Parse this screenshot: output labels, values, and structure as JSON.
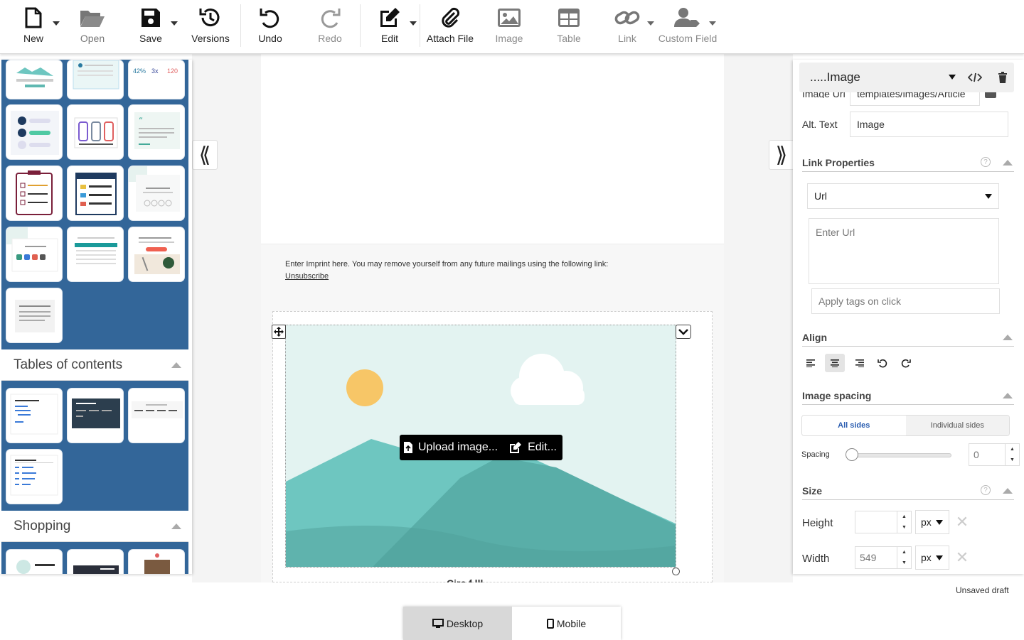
{
  "toolbar": {
    "new": "New",
    "open": "Open",
    "save": "Save",
    "versions": "Versions",
    "undo": "Undo",
    "redo": "Redo",
    "edit": "Edit",
    "attach_file": "Attach File",
    "image": "Image",
    "table": "Table",
    "link": "Link",
    "custom_field": "Custom Field"
  },
  "left_panel": {
    "tile_numbers": [
      "42%",
      "3x",
      "120"
    ],
    "sections": [
      {
        "title": "Tables of contents"
      },
      {
        "title": "Shopping"
      }
    ]
  },
  "canvas": {
    "imprint_text": "Enter Imprint here. You may remove yourself from any future mailings using the following link:",
    "unsubscribe": "Unsubscribe",
    "upload_image": "Upload image...",
    "edit_image": "Edit...",
    "caption_fragment": "Circ f  lll"
  },
  "right_panel": {
    "header": ".....Image",
    "image_url_label": "Image Url",
    "image_url_value": "templates/images/Article",
    "alt_text_label": "Alt. Text",
    "alt_text_value": "Image",
    "link_properties": "Link Properties",
    "link_type": "Url",
    "url_placeholder": "Enter Url",
    "tags_placeholder": "Apply tags on click",
    "align": "Align",
    "image_spacing": "Image spacing",
    "all_sides": "All sides",
    "individual_sides": "Individual sides",
    "spacing_label": "Spacing",
    "spacing_value": "0",
    "size": "Size",
    "height_label": "Height",
    "height_value": "",
    "height_unit": "px",
    "width_label": "Width",
    "width_value": "549",
    "width_unit": "px"
  },
  "status": {
    "unsaved": "Unsaved draft"
  },
  "device_toggle": {
    "desktop": "Desktop",
    "mobile": "Mobile",
    "active": "Desktop"
  },
  "colors": {
    "panel_blue": "#336699",
    "accent_blue": "#2a5db0",
    "image_teal": "#5fb8b1",
    "sun": "#f7c667"
  }
}
